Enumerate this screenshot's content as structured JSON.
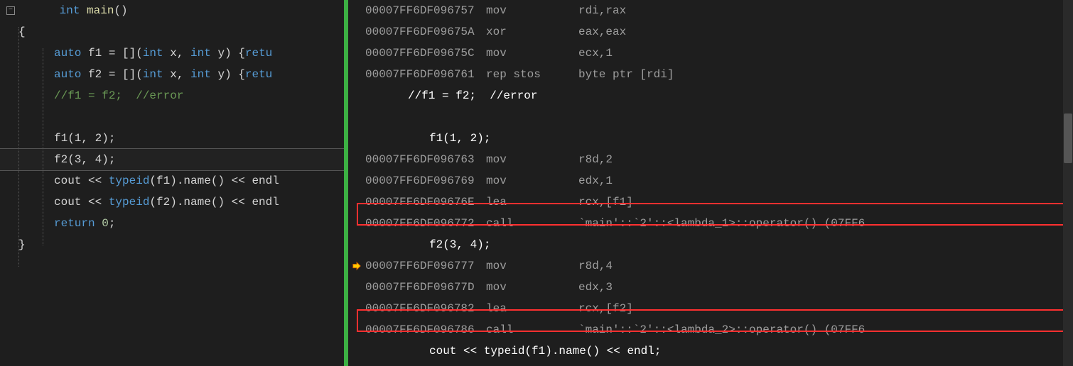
{
  "source": {
    "line1_pre": "int",
    "line1_func": " main",
    "line1_post": "()",
    "brace_open": "{",
    "l3_auto": "auto",
    "l3_mid": " f1 = [](",
    "l3_int1": "int",
    "l3_x": " x, ",
    "l3_int2": "int",
    "l3_y": " y) {",
    "l3_ret": "retu",
    "l4_auto": "auto",
    "l4_mid": " f2 = [](",
    "l4_int1": "int",
    "l4_x": " x, ",
    "l4_int2": "int",
    "l4_y": " y) {",
    "l4_ret": "retu",
    "l5_comment": "//f1 = f2;  //error",
    "l7": "f1(1, 2);",
    "l8": "f2(3, 4);",
    "l9a": "cout << ",
    "l9_typeid": "typeid",
    "l9b": "(f1).name() << endl",
    "l10a": "cout << ",
    "l10_typeid": "typeid",
    "l10b": "(f2).name() << endl",
    "l11_ret": "return",
    "l11_zero": " 0",
    "l11_semi": ";",
    "brace_close": "}"
  },
  "asm": {
    "rows": [
      {
        "addr": "00007FF6DF096757",
        "mnem": "mov",
        "op": "rdi,rax"
      },
      {
        "addr": "00007FF6DF09675A",
        "mnem": "xor",
        "op": "eax,eax"
      },
      {
        "addr": "00007FF6DF09675C",
        "mnem": "mov",
        "op": "ecx,1"
      },
      {
        "addr": "00007FF6DF096761",
        "mnem": "rep stos",
        "op": "byte ptr [rdi]"
      }
    ],
    "src1": "//f1 = f2;  //error",
    "src2": "f1(1, 2);",
    "rows2": [
      {
        "addr": "00007FF6DF096763",
        "mnem": "mov",
        "op": "r8d,2"
      },
      {
        "addr": "00007FF6DF096769",
        "mnem": "mov",
        "op": "edx,1"
      },
      {
        "addr": "00007FF6DF09676E",
        "mnem": "lea",
        "op": "rcx,[f1]"
      },
      {
        "addr": "00007FF6DF096772",
        "mnem": "call",
        "op": "`main'::`2'::<lambda_1>::operator() (07FF6"
      }
    ],
    "src3": "f2(3, 4);",
    "rows3": [
      {
        "addr": "00007FF6DF096777",
        "mnem": "mov",
        "op": "r8d,4",
        "bp": true
      },
      {
        "addr": "00007FF6DF09677D",
        "mnem": "mov",
        "op": "edx,3"
      },
      {
        "addr": "00007FF6DF096782",
        "mnem": "lea",
        "op": "rcx,[f2]"
      },
      {
        "addr": "00007FF6DF096786",
        "mnem": "call",
        "op": "`main'::`2'::<lambda_2>::operator() (07FF6"
      }
    ],
    "src4": "cout << typeid(f1).name() << endl;"
  }
}
